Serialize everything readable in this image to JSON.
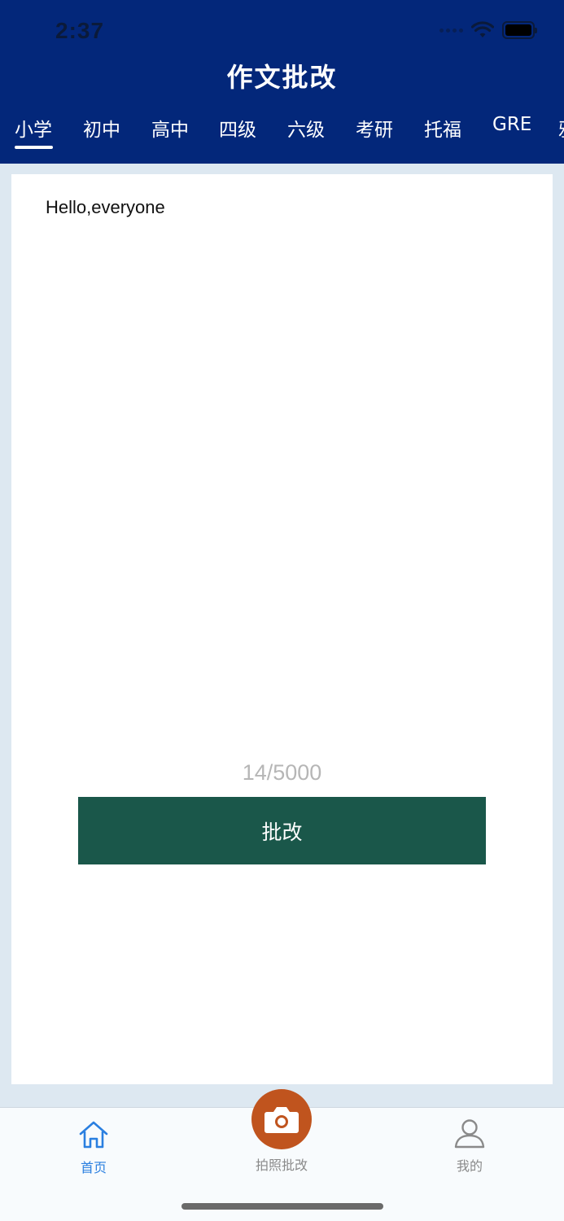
{
  "status_bar": {
    "time": "2:37"
  },
  "header": {
    "title": "作文批改"
  },
  "tabs": [
    {
      "label": "小学"
    },
    {
      "label": "初中"
    },
    {
      "label": "高中"
    },
    {
      "label": "四级"
    },
    {
      "label": "六级"
    },
    {
      "label": "考研"
    },
    {
      "label": "托福"
    },
    {
      "label": "GRE"
    },
    {
      "label": "雅"
    }
  ],
  "editor": {
    "text": "Hello,everyone",
    "counter": "14/5000",
    "submit_label": "批改"
  },
  "bottom_nav": {
    "home_label": "首页",
    "camera_label": "拍照批改",
    "profile_label": "我的"
  },
  "colors": {
    "header_bg": "#03277a",
    "submit_bg": "#1a574a",
    "camera_bg": "#c0541e",
    "active_nav": "#2a7fe0",
    "inactive_nav": "#8a8a8a"
  },
  "icons": [
    "wifi-icon",
    "battery-icon",
    "home-icon",
    "camera-icon",
    "user-icon"
  ]
}
